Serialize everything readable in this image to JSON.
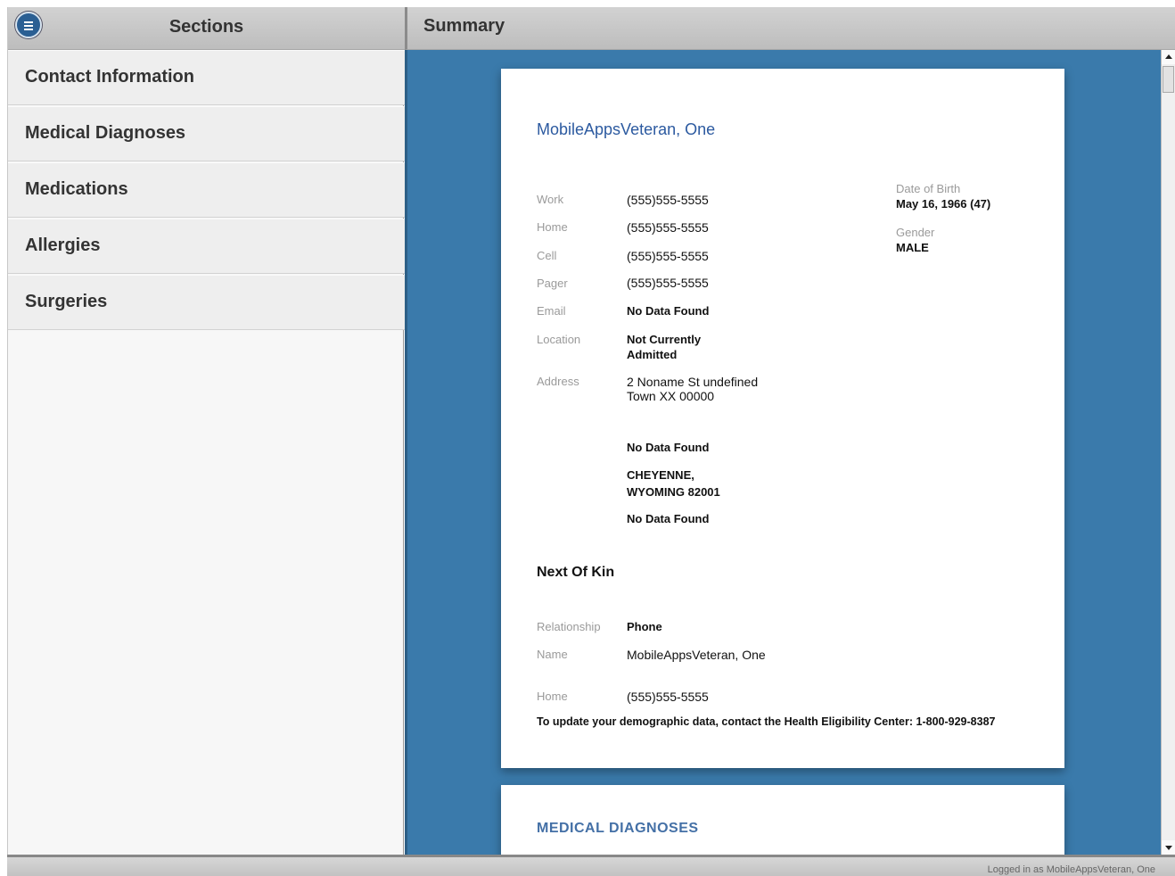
{
  "sidebar": {
    "title": "Sections",
    "items": [
      {
        "label": "Contact Information"
      },
      {
        "label": "Medical Diagnoses"
      },
      {
        "label": "Medications"
      },
      {
        "label": "Allergies"
      },
      {
        "label": "Surgeries"
      }
    ]
  },
  "main": {
    "title": "Summary"
  },
  "patient": {
    "name": "MobileAppsVeteran, One",
    "contact": [
      {
        "label": "Work",
        "value": "(555)555-5555"
      },
      {
        "label": "Home",
        "value": "(555)555-5555"
      },
      {
        "label": "Cell",
        "value": "(555)555-5555"
      },
      {
        "label": "Pager",
        "value": "(555)555-5555"
      },
      {
        "label": "Email",
        "value": "No Data Found"
      },
      {
        "label": "Location",
        "value_line1": "Not Currently",
        "value_line2": "Admitted"
      },
      {
        "label": "Address",
        "value_line1": "2 Noname St undefined",
        "value_line2": "Town XX 00000"
      }
    ],
    "extra_values": [
      {
        "value": "No Data Found"
      },
      {
        "value_line1": "CHEYENNE,",
        "value_line2": "WYOMING 82001"
      },
      {
        "value": "No Data Found"
      }
    ],
    "dob_label": "Date of Birth",
    "dob_value": "May 16, 1966 (47)",
    "gender_label": "Gender",
    "gender_value": "MALE"
  },
  "next_of_kin": {
    "title": "Next Of Kin",
    "relationship_label": "Relationship",
    "relationship_value": "Phone",
    "name_label": "Name",
    "name_value": "MobileAppsVeteran, One",
    "home_label": "Home",
    "home_value": "(555)555-5555"
  },
  "note": "To update your demographic data, contact the Health Eligibility Center: 1-800-929-8387",
  "next_card_title": "MEDICAL DIAGNOSES",
  "footer": {
    "status": "Logged in as MobileAppsVeteran, One"
  }
}
